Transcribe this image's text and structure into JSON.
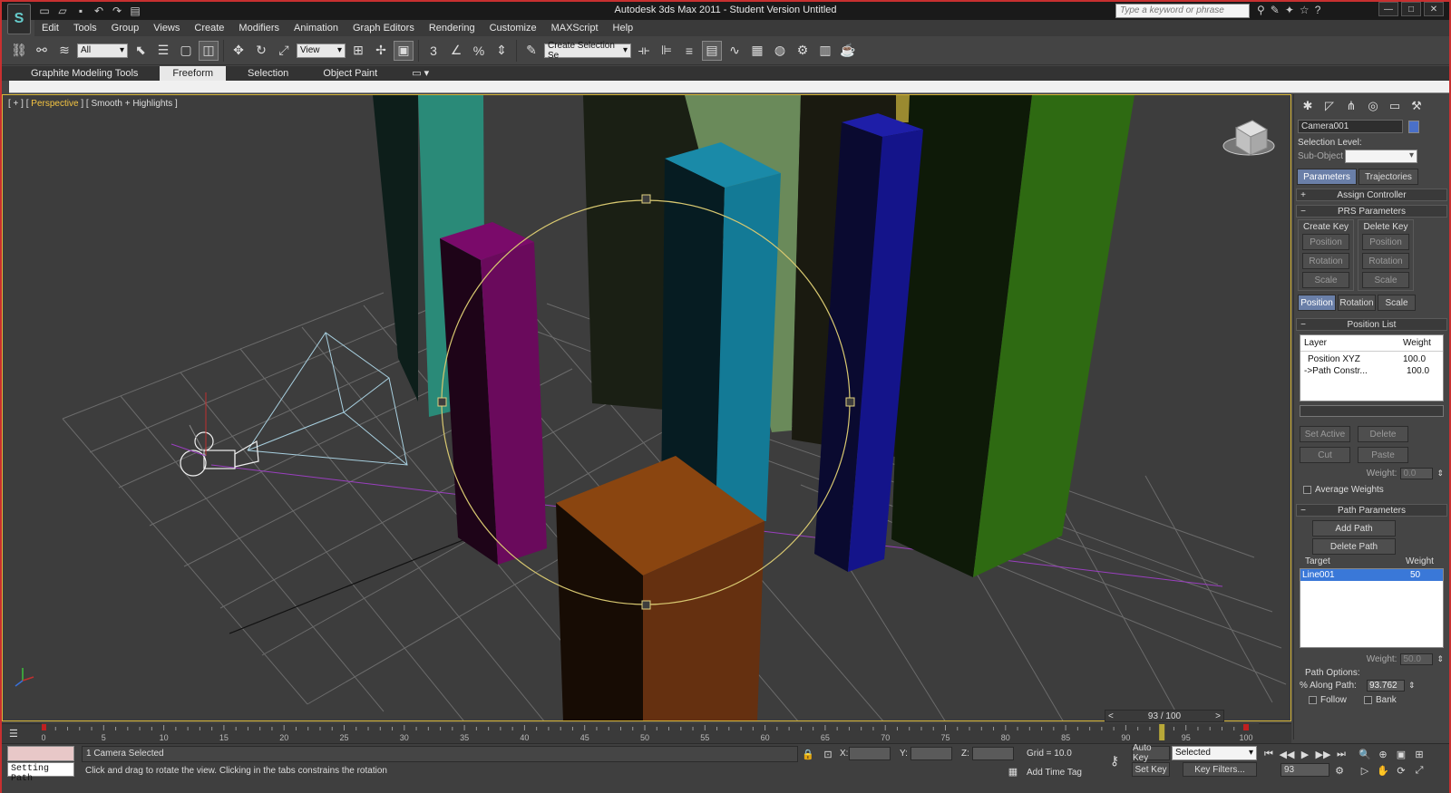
{
  "titlebar": {
    "title": "Autodesk 3ds Max  2011   - Student Version    Untitled",
    "search_placeholder": "Type a keyword or phrase",
    "app_logo": "3ds-max-logo"
  },
  "menu": [
    "Edit",
    "Tools",
    "Group",
    "Views",
    "Create",
    "Modifiers",
    "Animation",
    "Graph Editors",
    "Rendering",
    "Customize",
    "MAXScript",
    "Help"
  ],
  "toolbar": {
    "filter_value": "All",
    "refcoord_value": "View",
    "selection_set_placeholder": "Create Selection Se"
  },
  "ribbon": {
    "tabs": [
      "Graphite Modeling Tools",
      "Freeform",
      "Selection",
      "Object Paint"
    ],
    "active_tab": "Freeform"
  },
  "viewport": {
    "label_prefix": "[ + ] [",
    "label_view": "Perspective",
    "label_mid": "] [",
    "label_shading": "Smooth + Highlights",
    "label_suffix": "]"
  },
  "command_panel": {
    "object_name": "Camera001",
    "selection_level_label": "Selection Level:",
    "sub_object_label": "Sub-Object",
    "tabs": [
      "Parameters",
      "Trajectories"
    ],
    "assign_controller": "Assign Controller",
    "prs_parameters": "PRS Parameters",
    "create_key_label": "Create Key",
    "delete_key_label": "Delete Key",
    "key_buttons": [
      "Position",
      "Rotation",
      "Scale"
    ],
    "prs_tabs": [
      "Position",
      "Rotation",
      "Scale"
    ],
    "position_list": "Position List",
    "list_headers": [
      "Layer",
      "Weight"
    ],
    "list_rows": [
      {
        "layer": "Position XYZ",
        "weight": "100.0"
      },
      {
        "layer": "->Path Constr...",
        "weight": "100.0"
      }
    ],
    "set_active": "Set Active",
    "delete": "Delete",
    "cut": "Cut",
    "paste": "Paste",
    "weight_label": "Weight:",
    "weight_value": "0.0",
    "average_weights": "Average Weights",
    "path_parameters": "Path Parameters",
    "add_path": "Add Path",
    "delete_path": "Delete Path",
    "target_header": "Target",
    "weight_header": "Weight",
    "target_rows": [
      {
        "name": "Line001",
        "weight": "50"
      }
    ],
    "path_weight_label": "Weight:",
    "path_weight_value": "50.0",
    "path_options_label": "Path Options:",
    "along_path_label": "% Along Path:",
    "along_path_value": "93.762",
    "follow_label": "Follow",
    "bank_label": "Bank"
  },
  "timeline": {
    "frame_display": "93 / 100",
    "ticks": [
      "0",
      "5",
      "10",
      "15",
      "20",
      "25",
      "30",
      "35",
      "40",
      "45",
      "50",
      "55",
      "60",
      "65",
      "70",
      "75",
      "80",
      "85",
      "90",
      "95",
      "100"
    ],
    "current_frame": 93
  },
  "status": {
    "maxscript_listener": "Setting Path",
    "selection_status": "1 Camera Selected",
    "prompt": "Click and drag to rotate the view.  Clicking in the tabs constrains the rotation",
    "x_label": "X:",
    "y_label": "Y:",
    "z_label": "Z:",
    "grid": "Grid = 10.0",
    "add_time_tag": "Add Time Tag",
    "auto_key": "Auto Key",
    "set_key": "Set Key",
    "selected_value": "Selected",
    "key_filters": "Key Filters...",
    "frame_value": "93"
  }
}
